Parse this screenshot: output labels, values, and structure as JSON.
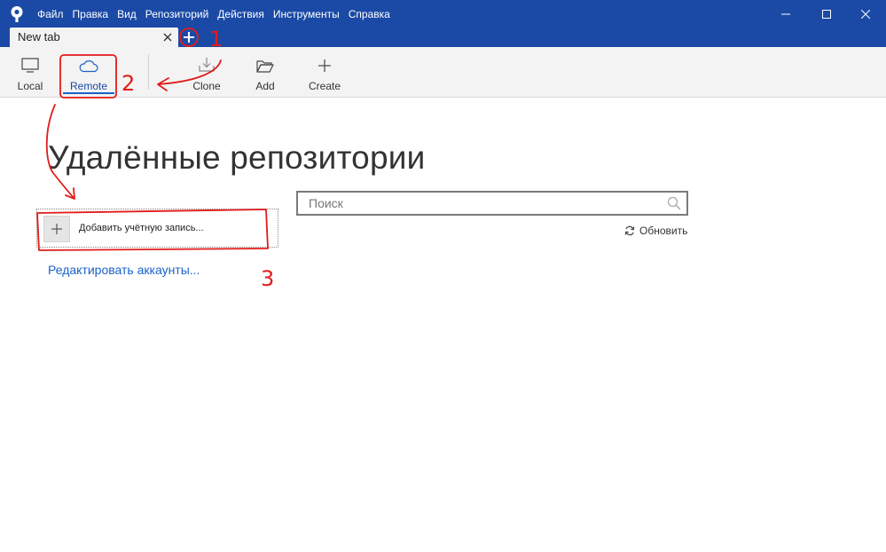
{
  "window": {
    "app_icon": "sourcetree-logo-icon",
    "menu": [
      "Файл",
      "Правка",
      "Вид",
      "Репозиторий",
      "Действия",
      "Инструменты",
      "Справка"
    ],
    "controls": [
      "minimize-icon",
      "maximize-icon",
      "close-icon"
    ]
  },
  "tabs": {
    "items": [
      {
        "label": "New tab"
      }
    ],
    "new_tab_icon": "plus-icon"
  },
  "toolbar": {
    "items": [
      {
        "label": "Local",
        "icon": "monitor-icon",
        "active": false
      },
      {
        "label": "Remote",
        "icon": "cloud-icon",
        "active": true
      },
      {
        "label": "Clone",
        "icon": "download-icon",
        "active": false
      },
      {
        "label": "Add",
        "icon": "folder-icon",
        "active": false
      },
      {
        "label": "Create",
        "icon": "plus-icon",
        "active": false
      }
    ]
  },
  "main": {
    "heading": "Удалённые репозитории",
    "add_account_label": "Добавить учётную запись...",
    "edit_accounts_label": "Редактировать аккаунты...",
    "search_placeholder": "Поиск",
    "search_value": "",
    "refresh_label": "Обновить"
  },
  "annotations": {
    "markers": [
      "1",
      "2",
      "3"
    ],
    "color": "#e21b1b"
  },
  "colors": {
    "titlebar": "#1b4aa6",
    "toolbar_bg": "#f3f3f3",
    "link": "#1b62c8",
    "active_underline": "#1b62c8"
  }
}
